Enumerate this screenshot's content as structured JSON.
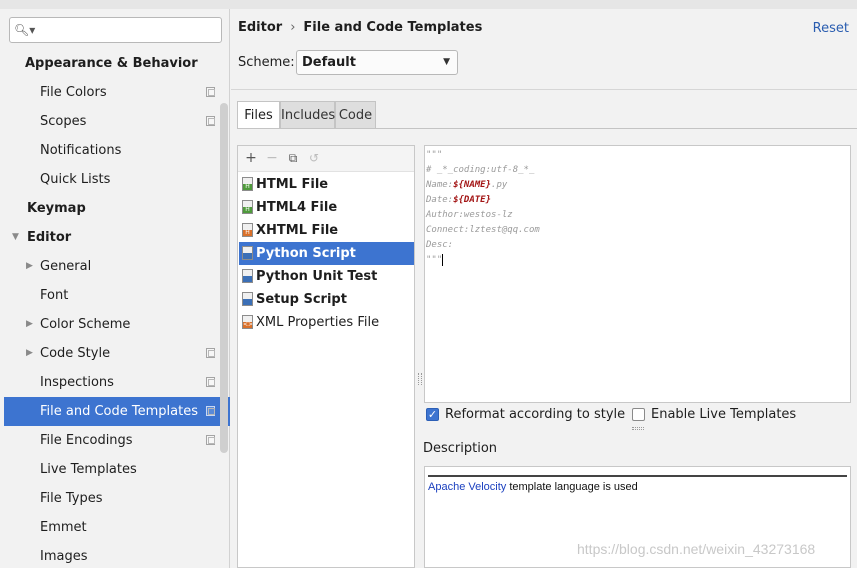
{
  "search": {
    "placeholder": ""
  },
  "sidebar": {
    "items": [
      {
        "label": "Appearance & Behavior"
      },
      {
        "label": "File Colors"
      },
      {
        "label": "Scopes"
      },
      {
        "label": "Notifications"
      },
      {
        "label": "Quick Lists"
      },
      {
        "label": "Keymap"
      },
      {
        "label": "Editor"
      },
      {
        "label": "General"
      },
      {
        "label": "Font"
      },
      {
        "label": "Color Scheme"
      },
      {
        "label": "Code Style"
      },
      {
        "label": "Inspections"
      },
      {
        "label": "File and Code Templates"
      },
      {
        "label": "File Encodings"
      },
      {
        "label": "Live Templates"
      },
      {
        "label": "File Types"
      },
      {
        "label": "Emmet"
      },
      {
        "label": "Images"
      }
    ]
  },
  "header": {
    "breadcrumb": [
      "Editor",
      "File and Code Templates"
    ],
    "separator": "›",
    "reset_label": "Reset"
  },
  "scheme": {
    "label": "Scheme:",
    "value": "Default"
  },
  "tabs": [
    {
      "label": "Files"
    },
    {
      "label": "Includes"
    },
    {
      "label": "Code"
    }
  ],
  "templates": [
    {
      "label": "HTML File",
      "badge": "H"
    },
    {
      "label": "HTML4 File",
      "badge": "H"
    },
    {
      "label": "XHTML File",
      "badge": "H"
    },
    {
      "label": "Python Script",
      "badge": ""
    },
    {
      "label": "Python Unit Test",
      "badge": ""
    },
    {
      "label": "Setup Script",
      "badge": ""
    },
    {
      "label": "XML Properties File",
      "badge": "<>"
    }
  ],
  "editor": {
    "lines": [
      "\"\"\"",
      "# _*_coding:utf-8_*_",
      "Name:",
      "Date:",
      "Author:westos-lz",
      "Connect:lztest@qq.com",
      "Desc:",
      "\"\"\""
    ],
    "name_var": "${NAME}",
    "name_suffix": ".py",
    "date_var": "${DATE}"
  },
  "options": {
    "reformat": {
      "label": "Reformat according to style",
      "checked": true
    },
    "live_templates": {
      "label": "Enable Live Templates",
      "checked": false
    }
  },
  "description": {
    "label": "Description",
    "link": "Apache Velocity",
    "text": " template language is used"
  },
  "watermark": "https://blog.csdn.net/weixin_43273168",
  "colors": {
    "selection": "#3d74d0",
    "link": "#2a5db0",
    "template_var": "#a31515"
  }
}
